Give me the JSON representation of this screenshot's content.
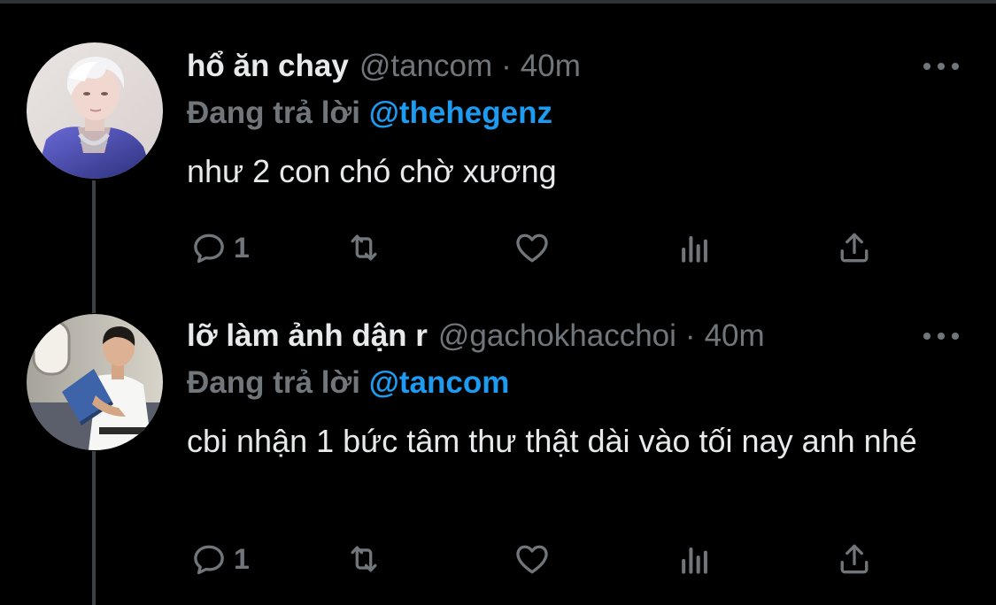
{
  "colors": {
    "background": "#000000",
    "text": "#e7e9ea",
    "muted": "#71767b",
    "link": "#1d9bf0",
    "thread_line": "#3e4144"
  },
  "tweets": [
    {
      "display_name": "hổ ăn chay",
      "handle": "@tancom",
      "separator": "·",
      "time": "40m",
      "reply_prefix": "Đang trả lời",
      "reply_to": "@thehegenz",
      "text": "như 2 con chó chờ xương",
      "reply_count": "1",
      "avatar_icon": "avatar-white-hair-person"
    },
    {
      "display_name": "lỡ làm ảnh dận r",
      "handle": "@gachokhacchoi",
      "separator": "·",
      "time": "40m",
      "reply_prefix": "Đang trả lời",
      "reply_to": "@tancom",
      "text": "cbi nhận 1 bức tâm thư thật dài vào tối nay anh nhé",
      "reply_count": "1",
      "avatar_icon": "avatar-person-reading"
    }
  ]
}
